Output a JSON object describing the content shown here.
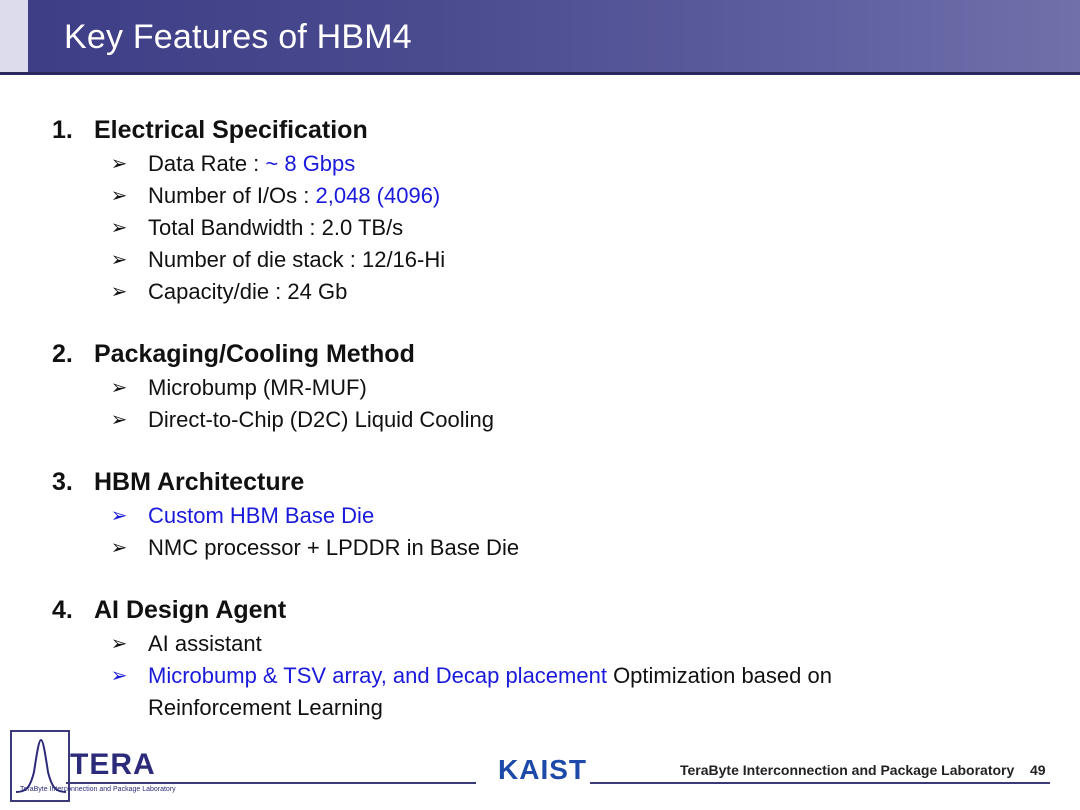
{
  "title": "Key Features of HBM4",
  "sections": [
    {
      "number": "1.",
      "heading": "Electrical Specification",
      "bullets": [
        {
          "label": "Data Rate : ",
          "value": "~ 8 Gbps"
        },
        {
          "label": "Number of I/Os : ",
          "value": "2,048 (4096)"
        },
        {
          "text": "Total Bandwidth : 2.0 TB/s"
        },
        {
          "text": "Number of die stack : 12/16-Hi"
        },
        {
          "text": "Capacity/die : 24 Gb"
        }
      ]
    },
    {
      "number": "2.",
      "heading": "Packaging/Cooling Method",
      "bullets": [
        {
          "text": "Microbump (MR-MUF)"
        },
        {
          "text": "Direct-to-Chip (D2C) Liquid Cooling"
        }
      ]
    },
    {
      "number": "3.",
      "heading": "HBM Architecture",
      "bullets": [
        {
          "highlight": "Custom HBM Base Die"
        },
        {
          "text": "NMC processor + LPDDR in Base Die"
        }
      ]
    },
    {
      "number": "4.",
      "heading": "AI Design Agent",
      "bullets": [
        {
          "text": "AI assistant"
        },
        {
          "highlight": "Microbump & TSV array, and Decap placement",
          "rest": " Optimization based on",
          "line2": "Reinforcement Learning"
        }
      ]
    }
  ],
  "footer": {
    "tera": "TERA",
    "tera_sub": "TeraByte Interconnection and Package Laboratory",
    "kaist": "KAIST",
    "lab": "TeraByte Interconnection and Package Laboratory",
    "page": "49"
  },
  "colors": {
    "highlight": "#1a1adb",
    "title_bar": "#4a4a8f"
  },
  "icons": {
    "bullet": "arrow-bullet-icon"
  }
}
